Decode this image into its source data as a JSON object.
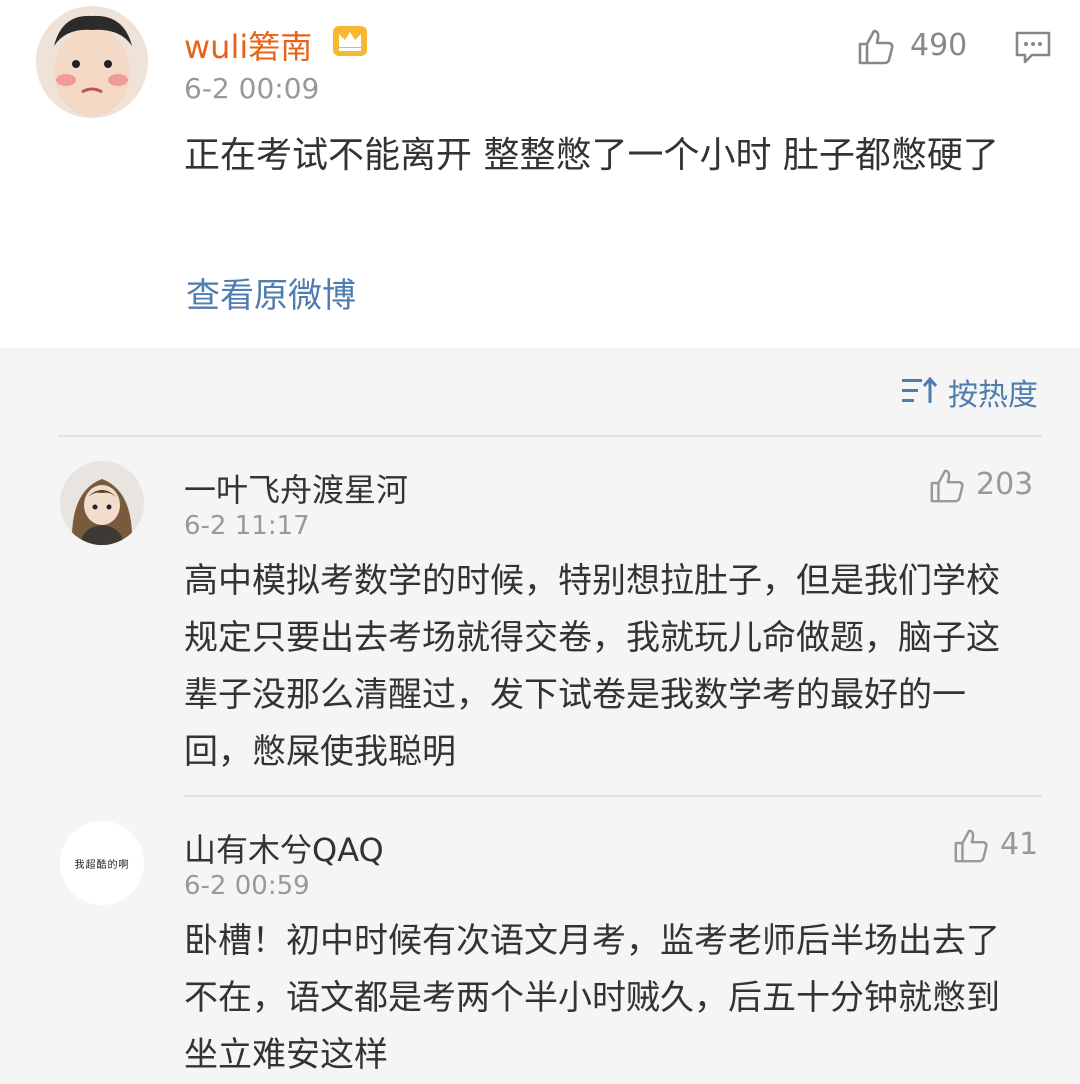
{
  "post": {
    "author": "wuli箬南",
    "time": "6-2 00:09",
    "like_count": "490",
    "text": "正在考试不能离开 整整憋了一个小时 肚子都憋硬了",
    "view_original": "查看原微博"
  },
  "sort": {
    "label": "按热度"
  },
  "comments": [
    {
      "author": "一叶飞舟渡星河",
      "time": "6-2 11:17",
      "like_count": "203",
      "text": "高中模拟考数学的时候，特别想拉肚子，但是我们学校规定只要出去考场就得交卷，我就玩儿命做题，脑子这辈子没那么清醒过，发下试卷是我数学考的最好的一回，憋屎使我聪明"
    },
    {
      "author": "山有木兮QAQ",
      "time": "6-2 00:59",
      "like_count": "41",
      "avatar_text": "我超酷的啊",
      "text": "卧槽！初中时候有次语文月考，监考老师后半场出去了不在，语文都是考两个半小时贼久，后五十分钟就憋到坐立难安这样"
    }
  ],
  "colors": {
    "author_orange": "#e8631a",
    "link_blue": "#507daf",
    "muted_gray": "#999999",
    "background_gray": "#f5f5f5"
  },
  "icons": {
    "crown": "crown-icon",
    "like": "thumbs-up-icon",
    "comment": "comment-icon",
    "sort": "sort-icon"
  }
}
